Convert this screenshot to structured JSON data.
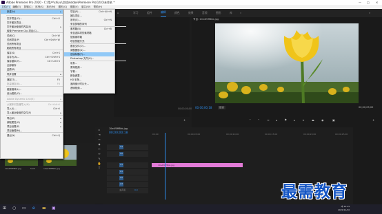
{
  "app": {
    "title": "Adobe Premiere Pro 2020 - C:\\用户\\shiyu\\文档\\Adobe\\Premiere Pro\\14.0\\未命名 *",
    "window_controls": [
      "—",
      "□",
      "✕"
    ]
  },
  "menubar": [
    "文件(F)",
    "编辑(E)",
    "剪辑(C)",
    "序列(S)",
    "标记(M)",
    "图形(G)",
    "视图(V)",
    "窗口(W)",
    "帮助(H)"
  ],
  "workspaces": [
    "学习",
    "组件",
    "编辑",
    "颜色",
    "效果",
    "音频",
    "图形",
    "库",
    "»"
  ],
  "file_menu": {
    "items": [
      {
        "label": "新建(N)",
        "shortcut": "",
        "submenu": true,
        "state": "highlighted"
      },
      {
        "label": "打开项目(O)...",
        "shortcut": "Ctrl+O"
      },
      {
        "label": "打开团队项目...",
        "shortcut": ""
      },
      {
        "label": "打开最近使用的内容(E)",
        "shortcut": "",
        "submenu": true
      },
      {
        "label": "转换 Premiere Clip 项目(C)...",
        "shortcut": ""
      },
      {
        "label": "关闭(C)",
        "shortcut": "Ctrl+W"
      },
      {
        "label": "关闭项目(P)",
        "shortcut": "Ctrl+Shift+W"
      },
      {
        "label": "关闭所有项目",
        "shortcut": ""
      },
      {
        "label": "刷新所有项目",
        "shortcut": ""
      },
      {
        "label": "保存(S)",
        "shortcut": "Ctrl+S"
      },
      {
        "label": "另存为(A)...",
        "shortcut": "Ctrl+Shift+S"
      },
      {
        "label": "保存副本(Y)...",
        "shortcut": "Ctrl+Alt+S"
      },
      {
        "label": "全部保存",
        "shortcut": ""
      },
      {
        "label": "还原(R)",
        "shortcut": ""
      },
      {
        "label": "同步设置",
        "shortcut": "",
        "submenu": true
      },
      {
        "label": "捕捉(T)...",
        "shortcut": "F5"
      },
      {
        "label": "批量捕捉(B)...",
        "shortcut": "F6",
        "state": "disabled"
      },
      {
        "label": "链接媒体(L)...",
        "shortcut": ""
      },
      {
        "label": "设为脱机(O)...",
        "shortcut": ""
      },
      {
        "label": "Adobe Dynamic Link(K)",
        "shortcut": "",
        "submenu": true,
        "state": "disabled"
      },
      {
        "label": "从媒体浏览器导入(M)",
        "shortcut": "Ctrl+Alt+I",
        "state": "disabled"
      },
      {
        "label": "导入(I)...",
        "shortcut": "Ctrl+I"
      },
      {
        "label": "导入最近使用的文件(F)",
        "shortcut": "",
        "submenu": true
      },
      {
        "label": "导出(E)",
        "shortcut": "",
        "submenu": true
      },
      {
        "label": "获取属性(G)",
        "shortcut": "",
        "submenu": true
      },
      {
        "label": "项目设置(P)",
        "shortcut": "",
        "submenu": true
      },
      {
        "label": "项目管理(M)...",
        "shortcut": ""
      },
      {
        "label": "退出(X)",
        "shortcut": "Ctrl+Q"
      }
    ]
  },
  "new_submenu": {
    "items": [
      {
        "label": "项目(P)...",
        "shortcut": "Ctrl+Alt+N"
      },
      {
        "label": "团队项目...",
        "shortcut": ""
      },
      {
        "label": "序列(S)...",
        "shortcut": "Ctrl+N"
      },
      {
        "label": "来自剪辑的序列",
        "shortcut": ""
      },
      {
        "label": "素材箱(B)",
        "shortcut": "Ctrl+B"
      },
      {
        "label": "来自选择项的素材箱",
        "shortcut": ""
      },
      {
        "label": "搜索素材箱",
        "shortcut": ""
      },
      {
        "label": "项目快捷方式",
        "shortcut": ""
      },
      {
        "label": "脱机文件(O)...",
        "shortcut": ""
      },
      {
        "label": "调整图层(A)...",
        "shortcut": ""
      },
      {
        "label": "旧版标题(T)...",
        "shortcut": "",
        "state": "highlighted"
      },
      {
        "label": "Photoshop 文件(H)...",
        "shortcut": ""
      },
      {
        "label": "彩条...",
        "shortcut": ""
      },
      {
        "label": "黑场视频...",
        "shortcut": ""
      },
      {
        "label": "字幕...",
        "shortcut": ""
      },
      {
        "label": "颜色遮罩...",
        "shortcut": ""
      },
      {
        "label": "HD 彩条...",
        "shortcut": ""
      },
      {
        "label": "通用倒计时片头...",
        "shortcut": ""
      },
      {
        "label": "透明视频...",
        "shortcut": ""
      }
    ]
  },
  "program_monitor": {
    "tab": "节目: 10e4f0ff8bb.jpg",
    "timecode": "00;00;00;18",
    "fit": "适合",
    "timecode_end": "00;00;05;00"
  },
  "source_monitor": {
    "timecode": "00;00;00;00"
  },
  "project": {
    "items": [
      {
        "name": "10e4f0ff8bb.jpg",
        "duration": "5;00"
      },
      {
        "name": "10e4f0ff8bb.jpg",
        "duration": "5;00"
      }
    ]
  },
  "timeline": {
    "tab": "10e4f0ff8bb.jpg",
    "timecode": "00;00;00;18",
    "ruler": [
      ":00;00",
      "00;00;05;00",
      "00;00;10;00",
      "00;00;15;00",
      "00;00;20;00",
      "00;00;25;00"
    ],
    "tracks": [
      "V3",
      "V2",
      "V1",
      "A1",
      "A2",
      "A3",
      "主声道"
    ],
    "master_value": "0.0",
    "clip": "10e4f0ff8bb.jpg"
  },
  "tools": [
    "▸",
    "⇥",
    "⇿",
    "◆",
    "✂",
    "↔",
    "✎",
    "✋",
    "T"
  ],
  "taskbar": {
    "time": "14:25",
    "date": "2021/11/10",
    "ime": "中"
  },
  "watermark": "最需教育",
  "colors": {
    "accent": "#2d8ceb",
    "clip": "#e27bd7",
    "menu_highlight": "#91c9f7"
  }
}
